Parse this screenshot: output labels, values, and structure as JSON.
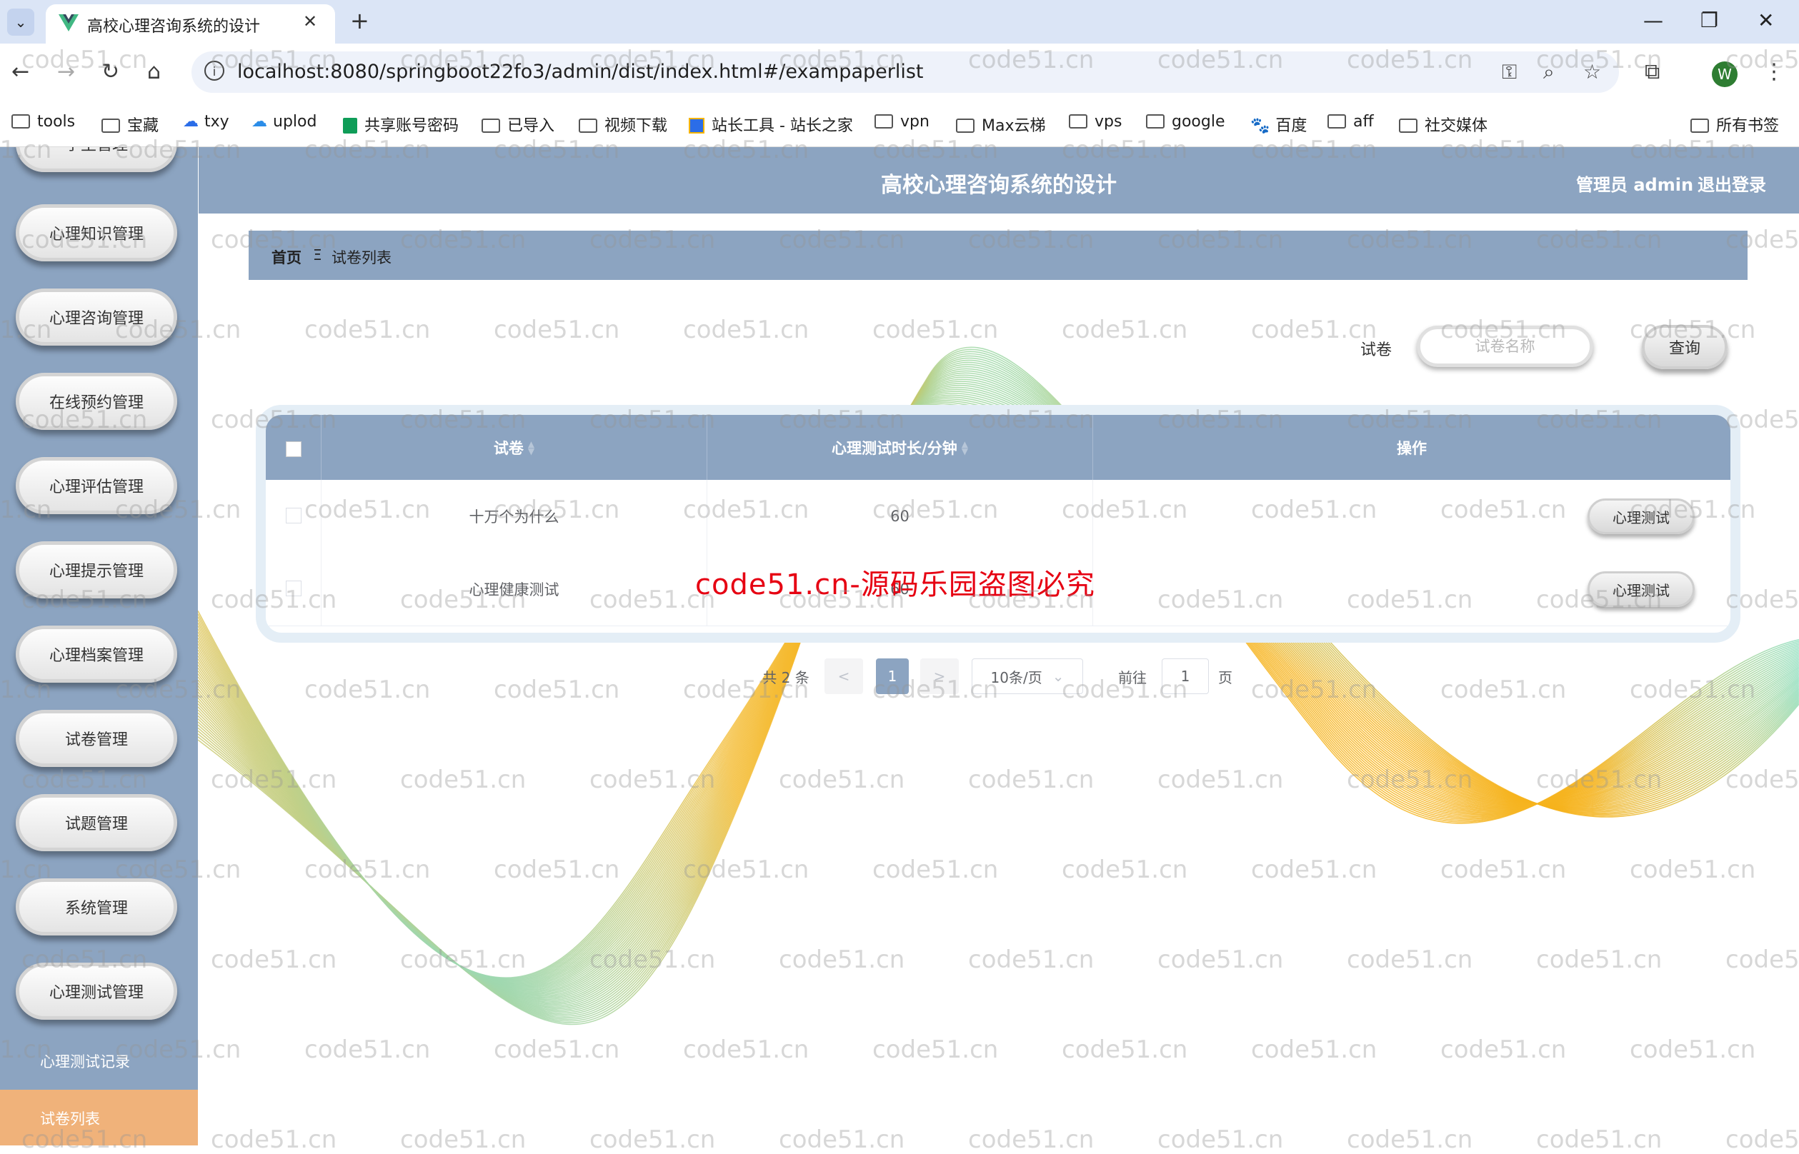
{
  "browser": {
    "tab_title": "高校心理咨询系统的设计",
    "url": "localhost:8080/springboot22fo3/admin/dist/index.html#/exampaperlist",
    "profile_initial": "W",
    "bookmarks": [
      "tools",
      "宝藏",
      "txy",
      "uplod",
      "共享账号密码",
      "已导入",
      "视频下载",
      "站长工具 - 站长之家",
      "vpn",
      "Max云梯",
      "vps",
      "google",
      "百度",
      "aff",
      "社交媒体"
    ],
    "all_bookmarks": "所有书签"
  },
  "sidebar": {
    "items": [
      "学生管理",
      "心理知识管理",
      "心理咨询管理",
      "在线预约管理",
      "心理评估管理",
      "心理提示管理",
      "心理档案管理",
      "试卷管理",
      "试题管理",
      "系统管理",
      "心理测试管理"
    ],
    "sub_items": [
      "心理测试记录",
      "试卷列表"
    ],
    "accent": "#f0b27a",
    "color": "#8ca4c1"
  },
  "header": {
    "title": "高校心理咨询系统的设计",
    "user": "管理员 admin",
    "logout": "退出登录"
  },
  "breadcrumb": {
    "home": "首页",
    "separator": "Ξ",
    "current": "试卷列表"
  },
  "search": {
    "label": "试卷",
    "placeholder": "试卷名称",
    "button": "查询"
  },
  "table": {
    "columns": [
      "试卷",
      "心理测试时长/分钟",
      "操作"
    ],
    "rows": [
      {
        "name": "十万个为什么",
        "duration": "60",
        "action": "心理测试"
      },
      {
        "name": "心理健康测试",
        "duration": "60",
        "action": "心理测试"
      }
    ]
  },
  "pagination": {
    "total": "共 2 条",
    "prev": "<",
    "page": "1",
    "next": ">",
    "page_size": "10条/页",
    "goto_label": "前往",
    "goto_value": "1",
    "goto_unit": "页"
  },
  "watermark": {
    "text": "code51.cn",
    "overlay": "code51.cn-源码乐园盗图必究"
  }
}
